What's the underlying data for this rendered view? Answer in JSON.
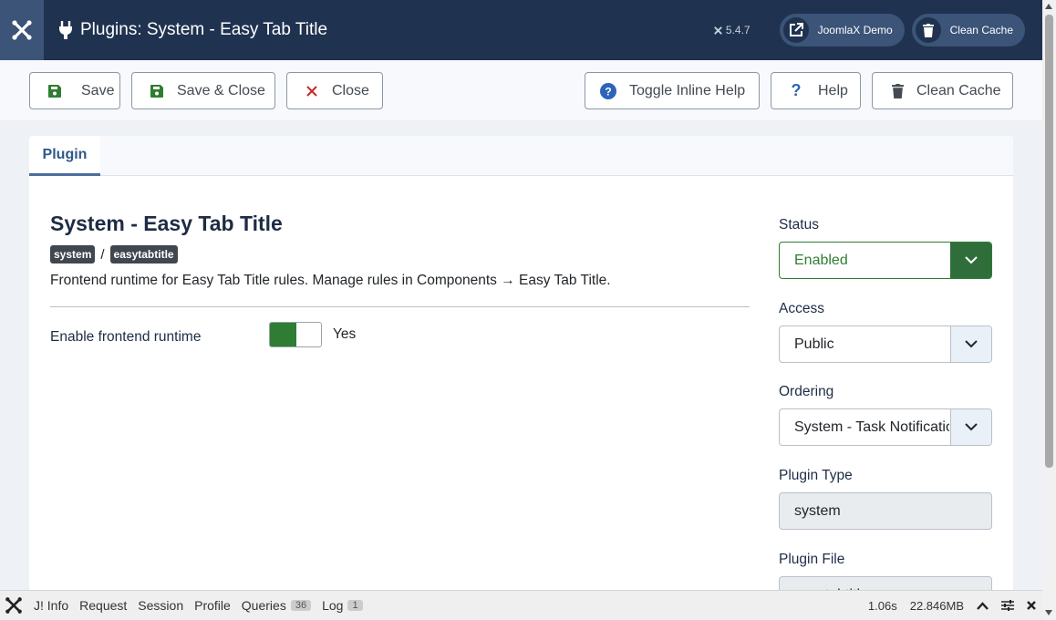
{
  "header": {
    "title": "Plugins: System - Easy Tab Title",
    "version": "5.4.7",
    "site_button": "JoomlaX Demo",
    "cache_button": "Clean Cache"
  },
  "toolbar": {
    "save": "Save",
    "save_close": "Save & Close",
    "close": "Close",
    "inline_help": "Toggle Inline Help",
    "help": "Help",
    "clean_cache": "Clean Cache"
  },
  "tabs": [
    {
      "label": "Plugin"
    }
  ],
  "plugin": {
    "name": "System - Easy Tab Title",
    "group": "system",
    "separator": "/",
    "element": "easytabtitle",
    "description": "Frontend runtime for Easy Tab Title rules. Manage rules in Components → Easy Tab Title."
  },
  "fields": {
    "runtime_label": "Enable frontend runtime",
    "runtime_value": "Yes"
  },
  "sidebar": {
    "status_label": "Status",
    "status_value": "Enabled",
    "access_label": "Access",
    "access_value": "Public",
    "ordering_label": "Ordering",
    "ordering_value": "System - Task Notification",
    "type_label": "Plugin Type",
    "type_value": "system",
    "file_label": "Plugin File",
    "file_value": "easytabtitle"
  },
  "debugbar": {
    "items": [
      "J! Info",
      "Request",
      "Session",
      "Profile",
      "Queries",
      "Log"
    ],
    "queries_count": "36",
    "log_count": "1",
    "time": "1.06s",
    "memory": "22.846MB"
  },
  "colors": {
    "header_bg": "#1f3250",
    "accent": "#2e5a8a",
    "success": "#2f7d32"
  }
}
